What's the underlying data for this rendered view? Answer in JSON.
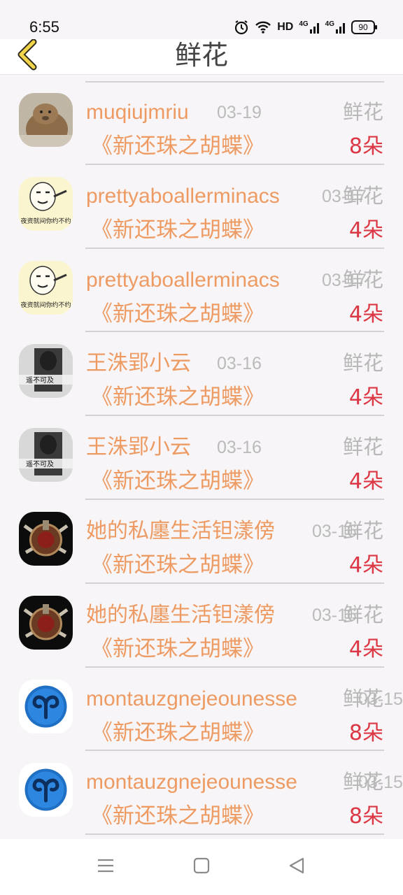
{
  "status": {
    "time": "6:55",
    "battery": "90",
    "hd": "HD",
    "net1": "4G",
    "net2": "4G"
  },
  "header": {
    "title": "鲜花"
  },
  "rows": [
    {
      "username": "muqiujmriu",
      "date": "03-19",
      "gift": "鲜花",
      "show": "《新还珠之胡蝶》",
      "count": "8朵",
      "avatar_icon": "hamster-avatar-icon"
    },
    {
      "username": "prettyaboallerminacs",
      "date": "03-17",
      "gift": "鲜花",
      "show": "《新还珠之胡蝶》",
      "count": "4朵",
      "avatar_icon": "meme-face-avatar-icon"
    },
    {
      "username": "prettyaboallerminacs",
      "date": "03-17",
      "gift": "鲜花",
      "show": "《新还珠之胡蝶》",
      "count": "4朵",
      "avatar_icon": "meme-face-avatar-icon"
    },
    {
      "username": "王洙郢小云",
      "date": "03-16",
      "gift": "鲜花",
      "show": "《新还珠之胡蝶》",
      "count": "4朵",
      "avatar_icon": "bw-photo-avatar-icon"
    },
    {
      "username": "王洙郢小云",
      "date": "03-16",
      "gift": "鲜花",
      "show": "《新还珠之胡蝶》",
      "count": "4朵",
      "avatar_icon": "bw-photo-avatar-icon"
    },
    {
      "username": "她的私廛生活钽漾傍",
      "date": "03-16",
      "gift": "鲜花",
      "show": "《新还珠之胡蝶》",
      "count": "4朵",
      "avatar_icon": "warcraft-crest-avatar-icon"
    },
    {
      "username": "她的私廛生活钽漾傍",
      "date": "03-16",
      "gift": "鲜花",
      "show": "《新还珠之胡蝶》",
      "count": "4朵",
      "avatar_icon": "warcraft-crest-avatar-icon"
    },
    {
      "username": "montauzgnejeounesse",
      "date": "03-15",
      "gift": "鲜花",
      "show": "《新还珠之胡蝶》",
      "count": "8朵",
      "avatar_icon": "aries-avatar-icon"
    },
    {
      "username": "montauzgnejeounesse",
      "date": "03-15",
      "gift": "鲜花",
      "show": "《新还珠之胡蝶》",
      "count": "8朵",
      "avatar_icon": "aries-avatar-icon"
    }
  ],
  "avatar_text": {
    "meme": "夜资就间你约不约",
    "bw": "遥不可及"
  },
  "colors": {
    "username": "#ee9b63",
    "count": "#dc3744",
    "muted": "#bbbbbb",
    "back": "#f2d54a"
  }
}
